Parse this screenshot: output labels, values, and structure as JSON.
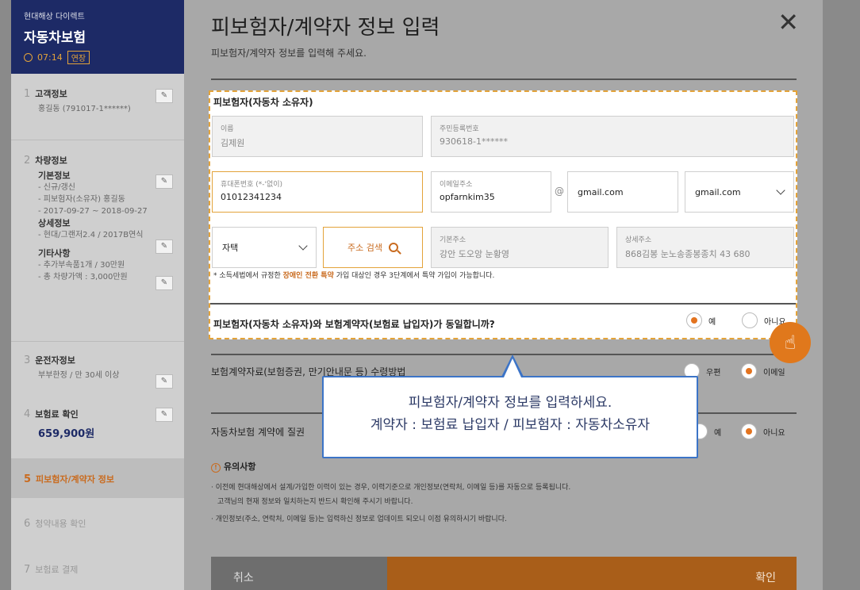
{
  "sidebar": {
    "company": "현대해상 다이렉트",
    "product": "자동차보험",
    "timer": "07:14",
    "extend_label": "연장",
    "steps": {
      "s1": {
        "num": "1",
        "title": "고객정보",
        "sub": "홍길동 (791017-1******)"
      },
      "s2": {
        "num": "2",
        "title": "차량정보",
        "basic_h": "기본정보",
        "basic_1": "- 신규/갱신",
        "basic_2": "- 피보험자(소유자) 홍길동",
        "basic_3": "- 2017-09-27 ~ 2018-09-27",
        "detail_h": "상세정보",
        "detail_1": "- 현대/그랜저2.4 / 2017B연식",
        "etc_h": "기타사항",
        "etc_1": "- 추가부속품1개 / 30만원",
        "etc_2": "- 총 차량가액 : 3,000만원"
      },
      "s3": {
        "num": "3",
        "title": "운전자정보",
        "sub": "부부한정 / 만 30세 이상"
      },
      "s4": {
        "num": "4",
        "title": "보험료 확인",
        "premium": "659,900원"
      },
      "s5": {
        "num": "5",
        "title": "피보험자/계약자 정보"
      },
      "s6": {
        "num": "6",
        "title": "청약내용 확인"
      },
      "s7": {
        "num": "7",
        "title": "보험료 결제"
      }
    }
  },
  "modal": {
    "title": "피보험자/계약자 정보 입력",
    "desc": "피보험자/계약자 정보를 입력해 주세요.",
    "section_title": "피보험자(자동차 소유자)",
    "name_label": "이름",
    "name_value": "김제원",
    "ssn_label": "주민등록번호",
    "ssn_value": "930618-1******",
    "phone_label": "휴대폰번호 (*-'없이)",
    "phone_value": "01012341234",
    "email_label": "이메일주소",
    "email_id": "opfarnkim35",
    "at": "@",
    "email_domain": "gmail.com",
    "email_select": "gmail.com",
    "addr_type": "자택",
    "addr_search": "주소 검색",
    "addr_basic_label": "기본주소",
    "addr_basic_value": "강안 도오앙 눈황영",
    "addr_detail_label": "상세주소",
    "addr_detail_value": "868김봉 눈노송종봉종치 43 680",
    "note_pre": "* 소득세법에서 규정한 ",
    "note_hl": "장애인 전환 특약",
    "note_post": " 가입 대상인 경우 3단계에서 특약 가입이 가능합니다.",
    "q1": "피보험자(자동차 소유자)와 보험계약자(보험료 납입자)가 동일합니까?",
    "yes": "예",
    "no": "아니요",
    "q2": "보험계약자료(보험증권, 만기안내문 등) 수령방법",
    "post": "우편",
    "email": "이메일",
    "q3": "자동차보험 계약에 질권",
    "notice_h": "유의사항",
    "notice_1": "· 이전에 현대해상에서 설계/가입한 이력이 있는 경우, 이력기준으로 개인정보(연락처, 이메일 등)를 자동으로 등록됩니다.",
    "notice_2": "고객님의 현재 정보와 일치하는지 반드시 확인해 주시기 바랍니다.",
    "notice_3": "· 개인정보(주소, 연락처, 이메일 등)는 입력하신 정보로 업데이트 되오니 이점 유의하시기 바랍니다.",
    "cancel": "취소",
    "confirm": "확인",
    "close_glyph": "✕"
  },
  "tooltip": {
    "line1": "피보험자/계약자 정보를 입력하세요.",
    "line2": "계약자 : 보험료 납입자 / 피보험자 : 자동차소유자"
  },
  "icons": {
    "hand": "☝"
  }
}
